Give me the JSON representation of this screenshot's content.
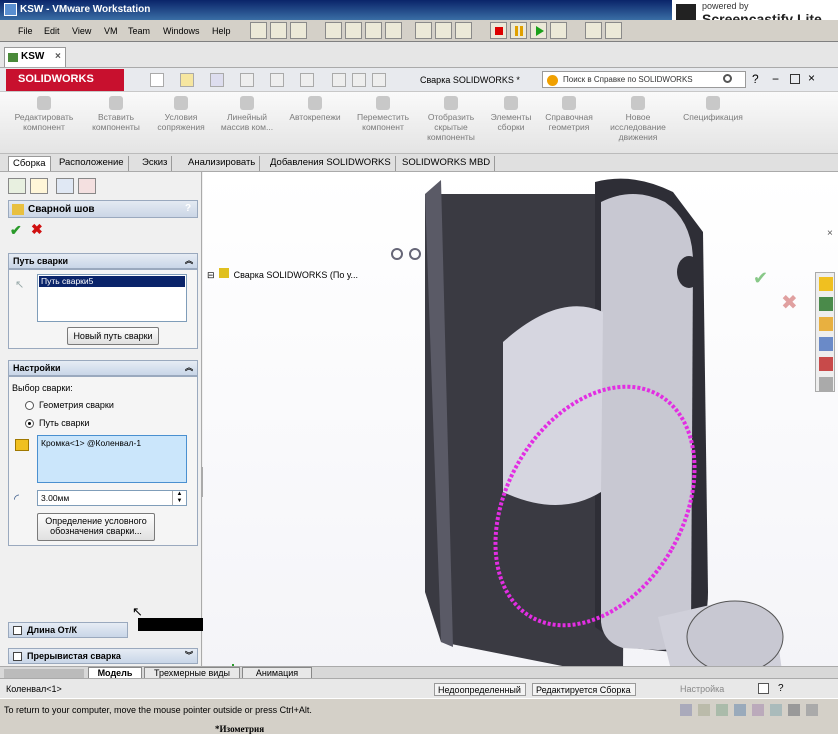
{
  "window": {
    "title": "KSW - VMware Workstation"
  },
  "screencastify": {
    "powered": "powered by",
    "brand": "Screencastify Lite"
  },
  "menu": [
    "File",
    "Edit",
    "View",
    "VM",
    "Team",
    "Windows",
    "Help"
  ],
  "vm_tab": {
    "label": "KSW"
  },
  "solidworks": {
    "logo": "SOLIDWORKS",
    "doc_title": "Сварка SOLIDWORKS *",
    "search_placeholder": "Поиск в Справке по SOLIDWORKS"
  },
  "ribbon": [
    {
      "label": "Редактировать\nкомпонент"
    },
    {
      "label": "Вставить\nкомпоненты"
    },
    {
      "label": "Условия\nсопряжения"
    },
    {
      "label": "Линейный\nмассив ком..."
    },
    {
      "label": "Автокрепежи"
    },
    {
      "label": "Переместить\nкомпонент"
    },
    {
      "label": "Отобразить\nскрытые\nкомпоненты"
    },
    {
      "label": "Элементы\nсборки"
    },
    {
      "label": "Справочная\nгеометрия"
    },
    {
      "label": "Новое\nисследование\nдвижения"
    },
    {
      "label": "Спецификация"
    }
  ],
  "cm_tabs": [
    "Сборка",
    "Расположение",
    "Эскиз",
    "Анализировать",
    "Добавления SOLIDWORKS",
    "SOLIDWORKS MBD"
  ],
  "pm": {
    "title": "Сварной шов",
    "help": "?",
    "path_section": "Путь сварки",
    "path_item": "Путь сварки5",
    "new_path_button": "Новый путь сварки",
    "settings_section": "Настройки",
    "weld_choice": "Выбор сварки:",
    "opt_geometry": "Геометрия сварки",
    "opt_path": "Путь сварки",
    "edge_item": "Кромка<1> @Коленвал-1",
    "size_value": "3.00мм",
    "symbol_button_line1": "Определение условного",
    "symbol_button_line2": "обозначения сварки...",
    "length_section": "Длина От/К",
    "intermittent_section": "Прерывистая сварка"
  },
  "tree": {
    "root": "Сварка SOLIDWORKS  (По у..."
  },
  "view": {
    "label": "*Изометрия"
  },
  "bottom_tabs": [
    "Модель",
    "Трехмерные виды",
    "Анимация"
  ],
  "status": {
    "component": "Коленвал<1>",
    "state1": "Недоопределенный",
    "state2": "Редактируется Сборка",
    "settings": "Настройка"
  },
  "vm_status": {
    "hint": "To return to your computer, move the mouse pointer outside or press Ctrl+Alt."
  },
  "colors": {
    "accent": "#c8102e",
    "weld": "#e22ee2",
    "model_dark": "#3a3a42"
  }
}
